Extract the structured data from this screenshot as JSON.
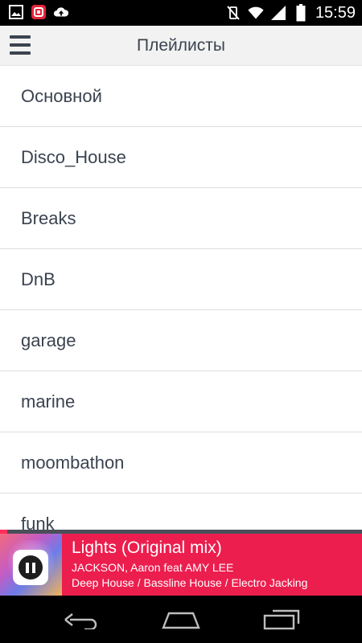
{
  "status_bar": {
    "time": "15:59",
    "left_icons": [
      "image-icon",
      "app-notification-icon",
      "cloud-upload-icon"
    ],
    "right_icons": [
      "vibrate-off-icon",
      "wifi-icon",
      "signal-icon",
      "battery-icon"
    ]
  },
  "action_bar": {
    "title": "Плейлисты"
  },
  "playlists": [
    "Основной",
    "Disco_House",
    "Breaks",
    "DnB",
    "garage",
    "marine",
    "moombathon",
    "funk"
  ],
  "player": {
    "title": "Lights (Original mix)",
    "artist": "JACKSON, Aaron feat AMY LEE",
    "genre": "Deep House / Bassline House / Electro Jacking",
    "progress": 0.02,
    "colors": {
      "background": "#ec1e4e",
      "progress": "#ff2f5a",
      "track": "#4a4f5a"
    }
  },
  "nav_bar": {
    "buttons": [
      "back-icon",
      "home-icon",
      "recent-apps-icon"
    ]
  }
}
